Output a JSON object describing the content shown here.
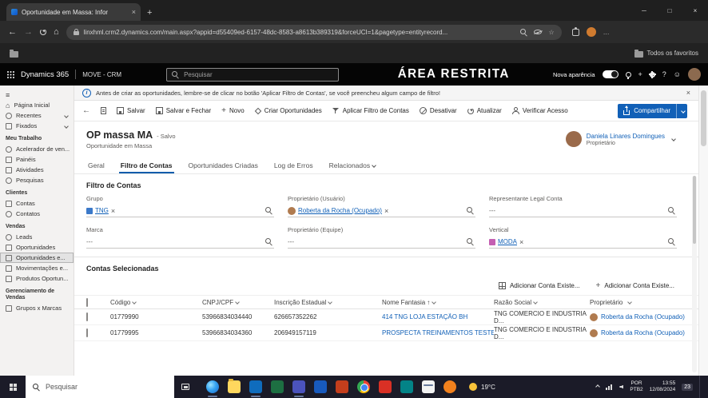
{
  "icons": {
    "menu": "≡",
    "home": "⌂",
    "back": "←",
    "forward": "→",
    "close": "×",
    "minimize": "─",
    "maximize": "□",
    "plus": "+",
    "ellipsis": "…",
    "star": "☆",
    "help": "?",
    "smiley": "☺",
    "info": "i",
    "sort_asc": "↑"
  },
  "browser": {
    "tab_title": "Oportunidade em Massa: Infor",
    "url": "linxhml.crm2.dynamics.com/main.aspx?appid=d55409ed-6157-48dc-8583-a8613b389319&forceUCI=1&pagetype=entityrecord...",
    "favorites_label": "Todos os favoritos"
  },
  "d365": {
    "brand": "Dynamics 365",
    "app": "MOVE - CRM",
    "search_placeholder": "Pesquisar",
    "banner": "ÁREA RESTRITA",
    "new_look": "Nova aparência"
  },
  "notification": {
    "message": "Antes de criar as oportunidades, lembre-se de clicar no botão 'Aplicar Filtro de Contas', se você preencheu algum campo de filtro!"
  },
  "command_bar": {
    "items": [
      {
        "label": "Salvar"
      },
      {
        "label": "Salvar e Fechar"
      },
      {
        "label": "Novo"
      },
      {
        "label": "Criar Oportunidades"
      },
      {
        "label": "Aplicar Filtro de Contas"
      },
      {
        "label": "Desativar"
      },
      {
        "label": "Atualizar"
      },
      {
        "label": "Verificar Acesso"
      }
    ],
    "share_label": "Compartilhar"
  },
  "record": {
    "title": "OP massa MA",
    "status": "- Salvo",
    "entity": "Oportunidade em Massa",
    "owner_name": "Daniela Linares Domingues",
    "owner_role": "Proprietário"
  },
  "tabs": {
    "items": [
      {
        "label": "Geral"
      },
      {
        "label": "Filtro de Contas"
      },
      {
        "label": "Oportunidades Criadas"
      },
      {
        "label": "Log de Erros"
      },
      {
        "label": "Relacionados"
      }
    ]
  },
  "sidebar": {
    "top_items": [
      {
        "label": "Página Inicial"
      },
      {
        "label": "Recentes"
      },
      {
        "label": "Fixados"
      }
    ],
    "sections": [
      {
        "title": "Meu Trabalho",
        "items": [
          "Acelerador de ven...",
          "Painéis",
          "Atividades",
          "Pesquisas"
        ]
      },
      {
        "title": "Clientes",
        "items": [
          "Contas",
          "Contatos"
        ]
      },
      {
        "title": "Vendas",
        "items": [
          "Leads",
          "Oportunidades",
          "Oportunidades e...",
          "Movimentações e...",
          "Produtos Oportun..."
        ]
      },
      {
        "title": "Gerenciamento de Vendas",
        "items": [
          "Grupos x Marcas"
        ]
      }
    ]
  },
  "filter_section": {
    "title": "Filtro de Contas",
    "fields": {
      "grupo": {
        "label": "Grupo",
        "value": "TNG"
      },
      "proprietario_usuario": {
        "label": "Proprietário (Usuário)",
        "value": "Roberta da Rocha (Ocupado)"
      },
      "representante": {
        "label": "Representante Legal Conta",
        "value": "---"
      },
      "marca": {
        "label": "Marca",
        "value": "---"
      },
      "proprietario_equipe": {
        "label": "Proprietário (Equipe)",
        "value": "---"
      },
      "vertical": {
        "label": "Vertical",
        "value": "MODA"
      }
    }
  },
  "accounts": {
    "title": "Contas Selecionadas",
    "add_buttons": [
      {
        "label": "Adicionar Conta Existe..."
      },
      {
        "label": "Adicionar Conta Existe..."
      }
    ],
    "columns": [
      "Código",
      "CNPJ/CPF",
      "Inscrição Estadual",
      "Nome Fantasia",
      "Razão Social",
      "Proprietário"
    ],
    "rows": [
      {
        "codigo": "01779990",
        "cnpj": "53966834034440",
        "ie": "626657352262",
        "nome": "414 TNG LOJA ESTAÇÃO BH",
        "razao": "TNG COMERCIO E INDUSTRIA D...",
        "prop": "Roberta da Rocha (Ocupado)"
      },
      {
        "codigo": "01779995",
        "cnpj": "53966834034360",
        "ie": "206949157119",
        "nome": "PROSPECTA TREINAMENTOS TESTESS",
        "razao": "TNG COMERCIO E INDUSTRIA D...",
        "prop": "Roberta da Rocha (Ocupado)"
      }
    ]
  },
  "taskbar": {
    "search_placeholder": "Pesquisar",
    "temperature": "19°C",
    "lang1": "POR",
    "lang2": "PTB2",
    "time": "13:55",
    "date": "12/08/2024",
    "badge": "23"
  }
}
